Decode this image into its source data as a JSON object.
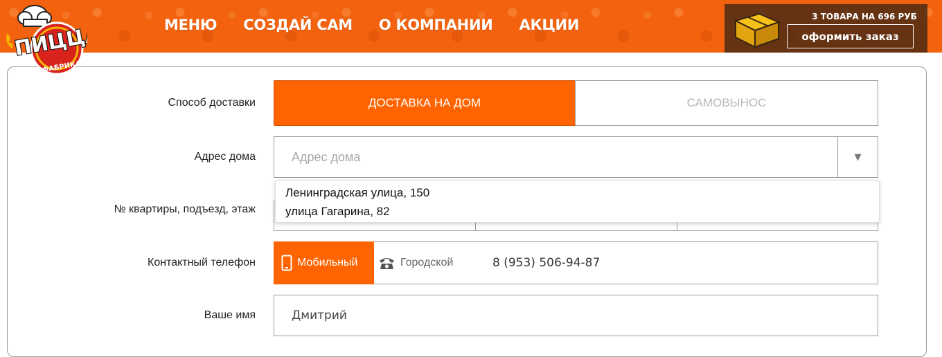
{
  "brand": {
    "logo_text": "ПИЦЦА",
    "logo_subtext": "ФАБРИКА",
    "colors": {
      "primary_orange": "#ff6400",
      "header_orange": "#f2620f",
      "cart_bg": "#46281a",
      "logo_red": "#d9231d"
    }
  },
  "nav": {
    "items": [
      {
        "label": "МЕНЮ"
      },
      {
        "label": "СОЗДАЙ САМ"
      },
      {
        "label": "О КОМПАНИИ"
      },
      {
        "label": "АКЦИИ"
      }
    ]
  },
  "cart": {
    "icon": "pizza-box-icon",
    "summary": "3 ТОВАРА НА 696 РУБ",
    "order_button": "оформить заказ"
  },
  "form": {
    "delivery": {
      "label": "Способ доставки",
      "options": [
        {
          "label": "ДОСТАВКА НА ДОМ",
          "selected": true
        },
        {
          "label": "САМОВЫНОС",
          "selected": false
        }
      ]
    },
    "address": {
      "label": "Адрес дома",
      "placeholder": "Адрес дома",
      "value": "",
      "dropdown_icon": "triangle-down-icon",
      "suggestions": [
        "Ленинградская улица, 150",
        "улица Гагарина, 82"
      ]
    },
    "apartment": {
      "label": "№ квартиры, подъезд, этаж"
    },
    "phone": {
      "label": "Контактный телефон",
      "types": [
        {
          "label": "Мобильный",
          "icon": "mobile-phone-icon",
          "selected": true
        },
        {
          "label": "Городской",
          "icon": "landline-phone-icon",
          "selected": false
        }
      ],
      "value": "8 (953) 506-94-87"
    },
    "name": {
      "label": "Ваше имя",
      "value": "Дмитрий"
    }
  }
}
